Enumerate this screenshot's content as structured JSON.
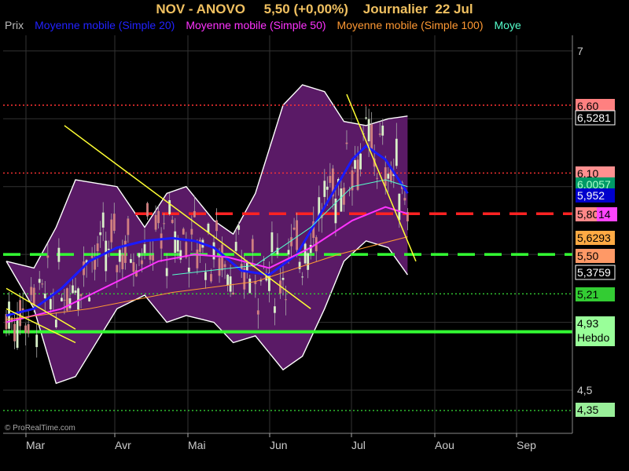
{
  "header": {
    "title": "NOV - ANOVO     5,50 (+0,00%)    Journalier  22 Jul",
    "legend": [
      {
        "label": "Prix",
        "color": "#bbbbbb"
      },
      {
        "label": "Moyenne mobile (Simple 20)",
        "color": "#2222ff"
      },
      {
        "label": "Moyenne mobile (Simple 50)",
        "color": "#ff33ff"
      },
      {
        "label": "Moyenne mobile (Simple 100)",
        "color": "#ff9933"
      },
      {
        "label": "Moye",
        "color": "#55ffcc"
      }
    ],
    "copyright": "© ProRealTime.com"
  },
  "chart_data": {
    "type": "line",
    "x_ticks": [
      "Mar",
      "Avr",
      "Mai",
      "Jun",
      "Jul",
      "Aou",
      "Sep"
    ],
    "y_ticks": [
      "7",
      "4,5"
    ],
    "ylim": [
      4.3,
      7.3
    ],
    "price_labels": [
      {
        "text": "6,60",
        "value": 6.6,
        "bg": "#ff8080",
        "fg": "#000"
      },
      {
        "text": "6,5281",
        "value": 6.5281,
        "bg": "#000000",
        "fg": "#ffffff",
        "border": "#ffffff"
      },
      {
        "text": "6,10",
        "value": 6.1,
        "bg": "#ff9090",
        "fg": "#000"
      },
      {
        "text": "6,0057",
        "value": 6.0057,
        "bg": "#009966",
        "fg": "#aaffcc"
      },
      {
        "text": "5,952",
        "value": 5.952,
        "bg": "#0000cc",
        "fg": "#ffffff"
      },
      {
        "text": "5,80",
        "value": 5.8,
        "bg": "#ff8888",
        "fg": "#000"
      },
      {
        "text": "5,8014",
        "value": 5.8014,
        "bg": "#ff44ff",
        "fg": "#000"
      },
      {
        "text": "5,6293",
        "value": 5.6293,
        "bg": "#ffaa44",
        "fg": "#000"
      },
      {
        "text": "5,50",
        "value": 5.5,
        "bg": "#ff9966",
        "fg": "#000"
      },
      {
        "text": "5,3759",
        "value": 5.3759,
        "bg": "#000000",
        "fg": "#ffffff",
        "border": "#ffffff"
      },
      {
        "text": "5,21",
        "value": 5.21,
        "bg": "#33cc33",
        "fg": "#000"
      },
      {
        "text": "4,93\nHebdo",
        "value": 4.93,
        "bg": "#99ff99",
        "fg": "#000"
      },
      {
        "text": "4,35",
        "value": 4.35,
        "bg": "#99ee99",
        "fg": "#000"
      }
    ],
    "horizontal_lines": [
      {
        "value": 6.6,
        "color": "#ff3333",
        "style": "dotted"
      },
      {
        "value": 6.1,
        "color": "#ff3333",
        "style": "dotted"
      },
      {
        "value": 5.8,
        "color": "#ff2222",
        "style": "dashed"
      },
      {
        "value": 5.5,
        "color": "#33ff33",
        "style": "dashed"
      },
      {
        "value": 5.21,
        "color": "#33cc33",
        "style": "dotted"
      },
      {
        "value": 4.93,
        "color": "#33ff33",
        "style": "solid"
      },
      {
        "value": 4.35,
        "color": "#33cc33",
        "style": "dotted"
      }
    ],
    "series": [
      {
        "name": "Moyenne mobile (Simple 20)",
        "color": "#1a1aff",
        "values": [
          [
            0,
            5.05
          ],
          [
            10,
            5.1
          ],
          [
            20,
            5.25
          ],
          [
            30,
            5.45
          ],
          [
            40,
            5.55
          ],
          [
            50,
            5.6
          ],
          [
            60,
            5.62
          ],
          [
            68,
            5.6
          ],
          [
            75,
            5.55
          ],
          [
            85,
            5.38
          ],
          [
            95,
            5.35
          ],
          [
            105,
            5.5
          ],
          [
            115,
            5.85
          ],
          [
            125,
            6.2
          ],
          [
            130,
            6.3
          ],
          [
            137,
            6.2
          ],
          [
            145,
            5.95
          ]
        ]
      },
      {
        "name": "Moyenne mobile (Simple 50)",
        "color": "#ff33ff",
        "values": [
          [
            0,
            5.0
          ],
          [
            20,
            5.1
          ],
          [
            40,
            5.3
          ],
          [
            55,
            5.45
          ],
          [
            68,
            5.5
          ],
          [
            80,
            5.48
          ],
          [
            95,
            5.4
          ],
          [
            110,
            5.55
          ],
          [
            125,
            5.75
          ],
          [
            137,
            5.85
          ],
          [
            145,
            5.8
          ]
        ]
      },
      {
        "name": "Moyenne mobile (Simple 100)",
        "color": "#ff9933",
        "values": [
          [
            0,
            5.02
          ],
          [
            30,
            5.1
          ],
          [
            60,
            5.22
          ],
          [
            90,
            5.3
          ],
          [
            120,
            5.5
          ],
          [
            145,
            5.63
          ]
        ]
      },
      {
        "name": "Moye",
        "color": "#55ffcc",
        "values": [
          [
            60,
            5.35
          ],
          [
            90,
            5.42
          ],
          [
            110,
            5.7
          ],
          [
            125,
            6.0
          ],
          [
            137,
            6.05
          ],
          [
            145,
            6.0
          ]
        ]
      }
    ],
    "bollinger_upper": [
      [
        0,
        5.45
      ],
      [
        10,
        5.4
      ],
      [
        18,
        5.7
      ],
      [
        25,
        6.05
      ],
      [
        40,
        6.0
      ],
      [
        50,
        5.7
      ],
      [
        58,
        5.95
      ],
      [
        65,
        6.0
      ],
      [
        75,
        5.75
      ],
      [
        82,
        5.65
      ],
      [
        90,
        5.95
      ],
      [
        100,
        6.6
      ],
      [
        107,
        6.75
      ],
      [
        115,
        6.7
      ],
      [
        122,
        6.48
      ],
      [
        130,
        6.45
      ],
      [
        138,
        6.5
      ],
      [
        145,
        6.52
      ]
    ],
    "bollinger_lower": [
      [
        0,
        5.45
      ],
      [
        10,
        5.1
      ],
      [
        18,
        4.55
      ],
      [
        25,
        4.6
      ],
      [
        40,
        5.1
      ],
      [
        50,
        5.2
      ],
      [
        58,
        5.0
      ],
      [
        65,
        5.05
      ],
      [
        75,
        5.0
      ],
      [
        82,
        4.85
      ],
      [
        90,
        4.9
      ],
      [
        100,
        4.65
      ],
      [
        107,
        4.75
      ],
      [
        115,
        5.1
      ],
      [
        122,
        5.45
      ],
      [
        130,
        5.6
      ],
      [
        138,
        5.55
      ],
      [
        145,
        5.35
      ]
    ],
    "trendlines": [
      {
        "from": [
          0,
          5.25
        ],
        "to": [
          25,
          4.95
        ]
      },
      {
        "from": [
          0,
          5.1
        ],
        "to": [
          25,
          4.85
        ]
      },
      {
        "from": [
          21,
          6.45
        ],
        "to": [
          110,
          5.1
        ]
      },
      {
        "from": [
          123,
          6.68
        ],
        "to": [
          148,
          5.45
        ]
      }
    ]
  }
}
